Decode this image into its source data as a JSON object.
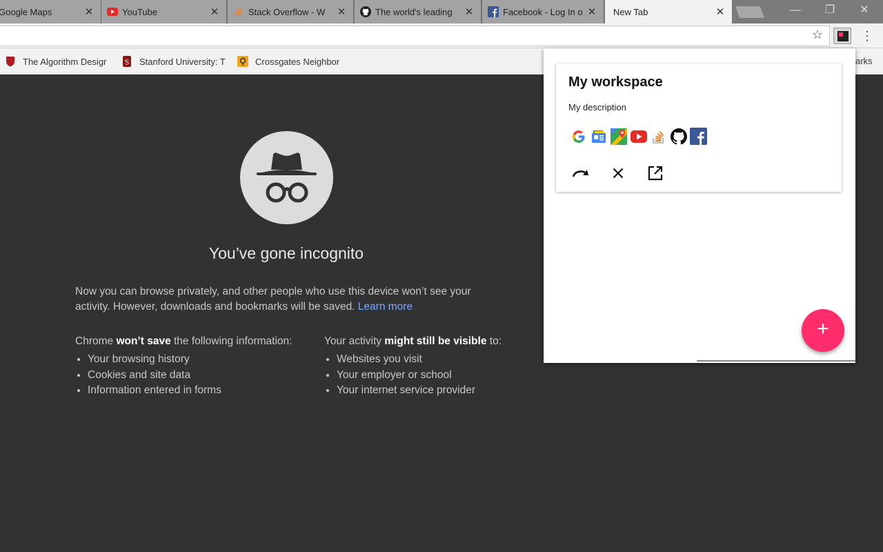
{
  "tabs": [
    {
      "title": "Google Maps",
      "close": "✕",
      "active": false
    },
    {
      "title": "YouTube",
      "close": "✕",
      "active": false
    },
    {
      "title": "Stack Overflow - W",
      "close": "✕",
      "active": false
    },
    {
      "title": "The world's leading",
      "close": "✕",
      "active": false
    },
    {
      "title": "Facebook - Log In o",
      "close": "✕",
      "active": false
    },
    {
      "title": "New Tab",
      "close": "✕",
      "active": true
    }
  ],
  "window_controls": {
    "minimize": "—",
    "restore": "❐",
    "close": "✕"
  },
  "toolbar": {
    "star": "☆",
    "menu": "⋮",
    "extension_icon": "workspace-extension-icon"
  },
  "bookmarks": [
    {
      "label": "The Algorithm Desigr"
    },
    {
      "label": "Stanford University: T"
    },
    {
      "label": "Crossgates Neighbor"
    }
  ],
  "bookmarks_more": "arks",
  "incognito": {
    "heading": "You’ve gone incognito",
    "paragraph": "Now you can browse privately, and other people who use this device won’t see your activity. However, downloads and bookmarks will be saved.",
    "learn_more": "Learn more",
    "left_head_pre": "Chrome ",
    "left_head_bold": "won’t save",
    "left_head_post": " the following information:",
    "left_items": [
      "Your browsing history",
      "Cookies and site data",
      "Information entered in forms"
    ],
    "right_head_pre": "Your activity ",
    "right_head_bold": "might still be visible",
    "right_head_post": " to:",
    "right_items": [
      "Websites you visit",
      "Your employer or school",
      "Your internet service provider"
    ]
  },
  "popup": {
    "workspace_title": "My workspace",
    "workspace_description": "My description",
    "site_icons": [
      "google-icon",
      "google-news-icon",
      "google-maps-icon",
      "youtube-icon",
      "stackoverflow-icon",
      "github-icon",
      "facebook-icon"
    ],
    "actions": [
      "redo-icon",
      "close-icon",
      "open-external-icon"
    ],
    "fab": "+"
  },
  "colors": {
    "fab": "#ff2d6b",
    "incognito_bg": "#323232",
    "link": "#7aa7ff"
  }
}
